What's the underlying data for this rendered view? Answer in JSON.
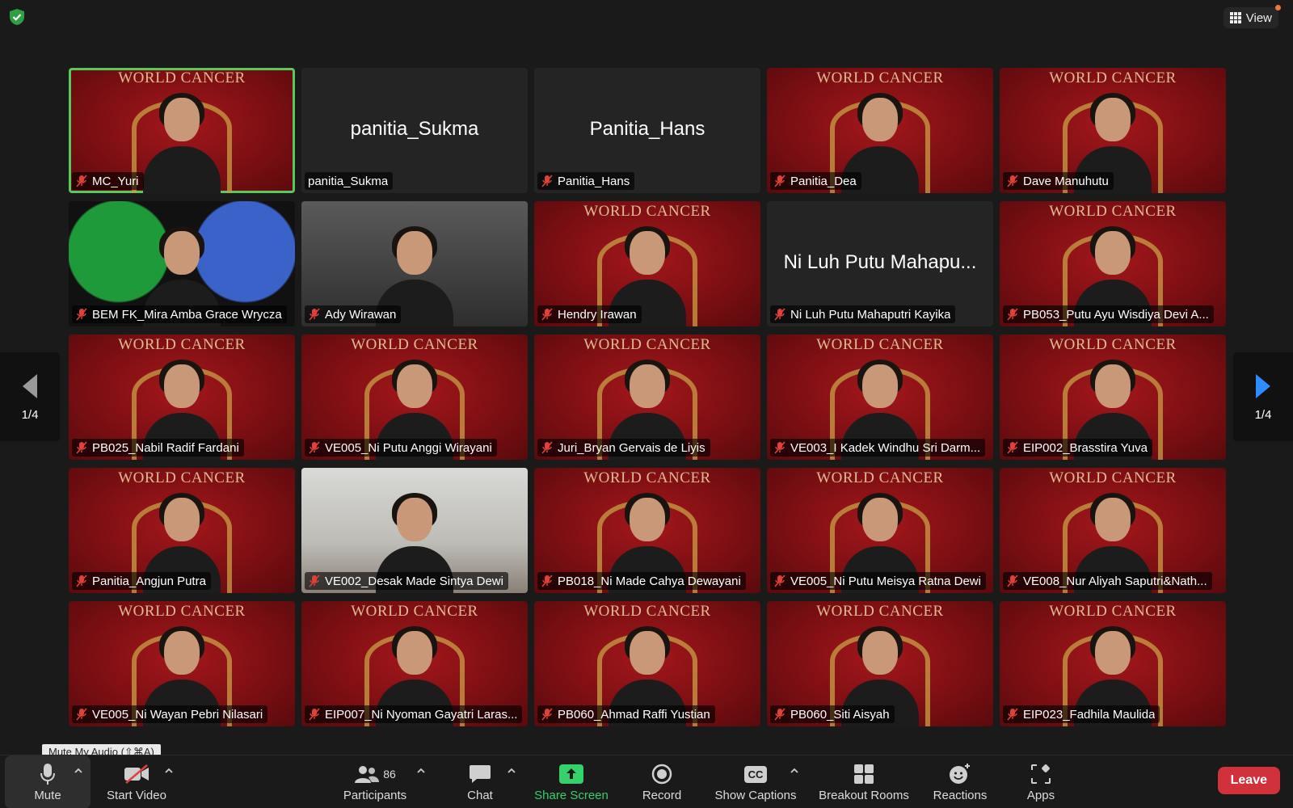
{
  "header": {
    "view_label": "View"
  },
  "pagination": {
    "left_label": "1/4",
    "right_label": "1/4"
  },
  "participants": [
    {
      "name": "MC_Yuri",
      "center_text": "",
      "bg": "red",
      "active": true,
      "muted": true
    },
    {
      "name": "panitia_Sukma",
      "center_text": "panitia_Sukma",
      "bg": "none",
      "active": false,
      "muted": false
    },
    {
      "name": "Panitia_Hans",
      "center_text": "Panitia_Hans",
      "bg": "none",
      "active": false,
      "muted": true
    },
    {
      "name": "Panitia_Dea",
      "center_text": "",
      "bg": "red",
      "active": false,
      "muted": true
    },
    {
      "name": "Dave Manuhutu",
      "center_text": "",
      "bg": "red",
      "active": false,
      "muted": true
    },
    {
      "name": "BEM FK_Mira Amba Grace Wrycza",
      "center_text": "",
      "bg": "batik",
      "active": false,
      "muted": true
    },
    {
      "name": "Ady Wirawan",
      "center_text": "",
      "bg": "dark",
      "active": false,
      "muted": true
    },
    {
      "name": "Hendry Irawan",
      "center_text": "",
      "bg": "red",
      "active": false,
      "muted": true
    },
    {
      "name": "Ni Luh Putu Mahaputri Kayika",
      "center_text": "Ni Luh Putu Mahapu...",
      "bg": "none",
      "active": false,
      "muted": true
    },
    {
      "name": "PB053_Putu Ayu Wisdiya Devi A...",
      "center_text": "",
      "bg": "red",
      "active": false,
      "muted": true
    },
    {
      "name": "PB025_Nabil Radif Fardani",
      "center_text": "",
      "bg": "red",
      "active": false,
      "muted": true
    },
    {
      "name": "VE005_Ni Putu Anggi Wirayani",
      "center_text": "",
      "bg": "red",
      "active": false,
      "muted": true
    },
    {
      "name": "Juri_Bryan Gervais de Liyis",
      "center_text": "",
      "bg": "red",
      "active": false,
      "muted": true
    },
    {
      "name": "VE003_I Kadek Windhu Sri Darm...",
      "center_text": "",
      "bg": "red",
      "active": false,
      "muted": true
    },
    {
      "name": "EIP002_Brasstira Yuva",
      "center_text": "",
      "bg": "red",
      "active": false,
      "muted": true
    },
    {
      "name": "Panitia_Angjun Putra",
      "center_text": "",
      "bg": "red",
      "active": false,
      "muted": true
    },
    {
      "name": "VE002_Desak Made Sintya Dewi",
      "center_text": "",
      "bg": "room",
      "active": false,
      "muted": true
    },
    {
      "name": "PB018_Ni Made Cahya Dewayani",
      "center_text": "",
      "bg": "red",
      "active": false,
      "muted": true
    },
    {
      "name": "VE005_Ni Putu Meisya Ratna Dewi",
      "center_text": "",
      "bg": "red",
      "active": false,
      "muted": true
    },
    {
      "name": "VE008_Nur Aliyah Saputri&Nath...",
      "center_text": "",
      "bg": "red",
      "active": false,
      "muted": true
    },
    {
      "name": "VE005_Ni Wayan Pebri Nilasari",
      "center_text": "",
      "bg": "red",
      "active": false,
      "muted": true
    },
    {
      "name": "EIP007_Ni Nyoman Gayatri Laras...",
      "center_text": "",
      "bg": "red",
      "active": false,
      "muted": true
    },
    {
      "name": "PB060_Ahmad Raffi Yustian",
      "center_text": "",
      "bg": "red",
      "active": false,
      "muted": true
    },
    {
      "name": "PB060_Siti Aisyah",
      "center_text": "",
      "bg": "red",
      "active": false,
      "muted": true
    },
    {
      "name": "EIP023_Fadhila Maulida",
      "center_text": "",
      "bg": "red",
      "active": false,
      "muted": true
    }
  ],
  "tooltip": "Mute My Audio (⇧⌘A)",
  "toolbar": {
    "mute_label": "Mute",
    "video_label": "Start Video",
    "participants_label": "Participants",
    "participants_count": "86",
    "chat_label": "Chat",
    "share_label": "Share Screen",
    "record_label": "Record",
    "captions_label": "Show Captions",
    "captions_icon_text": "CC",
    "breakout_label": "Breakout Rooms",
    "reactions_label": "Reactions",
    "apps_label": "Apps",
    "leave_label": "Leave"
  },
  "colors": {
    "active_speaker": "#58c95a",
    "share_green": "#35d16a",
    "leave_red": "#d0313a",
    "mute_slash": "#e0403a"
  }
}
